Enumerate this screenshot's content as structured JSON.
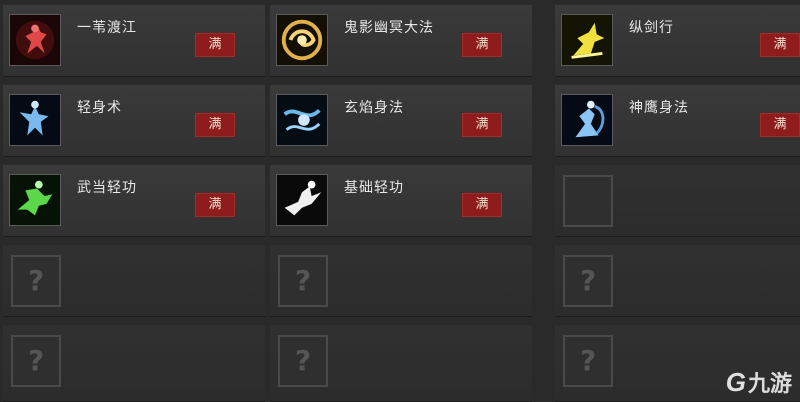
{
  "skills": [
    {
      "name": "一苇渡江",
      "badge": "满",
      "icon": "red-figure-icon",
      "color": "#d23a3a"
    },
    {
      "name": "鬼影幽冥大法",
      "badge": "满",
      "icon": "gold-swirl-icon",
      "color": "#e0b04a"
    },
    {
      "name": "纵剑行",
      "badge": "满",
      "icon": "yellow-leap-icon",
      "color": "#f0e040"
    },
    {
      "name": "轻身术",
      "badge": "满",
      "icon": "blue-figure-icon",
      "color": "#4a9ad8"
    },
    {
      "name": "玄焰身法",
      "badge": "满",
      "icon": "blue-flame-icon",
      "color": "#6ab8e8"
    },
    {
      "name": "神鹰身法",
      "badge": "满",
      "icon": "blue-eagle-icon",
      "color": "#5aa0e0"
    },
    {
      "name": "武当轻功",
      "badge": "满",
      "icon": "green-figure-icon",
      "color": "#5ad84a"
    },
    {
      "name": "基础轻功",
      "badge": "满",
      "icon": "white-kick-icon",
      "color": "#e8e8e8"
    }
  ],
  "empty_slot_glyph": "?",
  "watermark": {
    "logo": "G",
    "text": "九游"
  }
}
